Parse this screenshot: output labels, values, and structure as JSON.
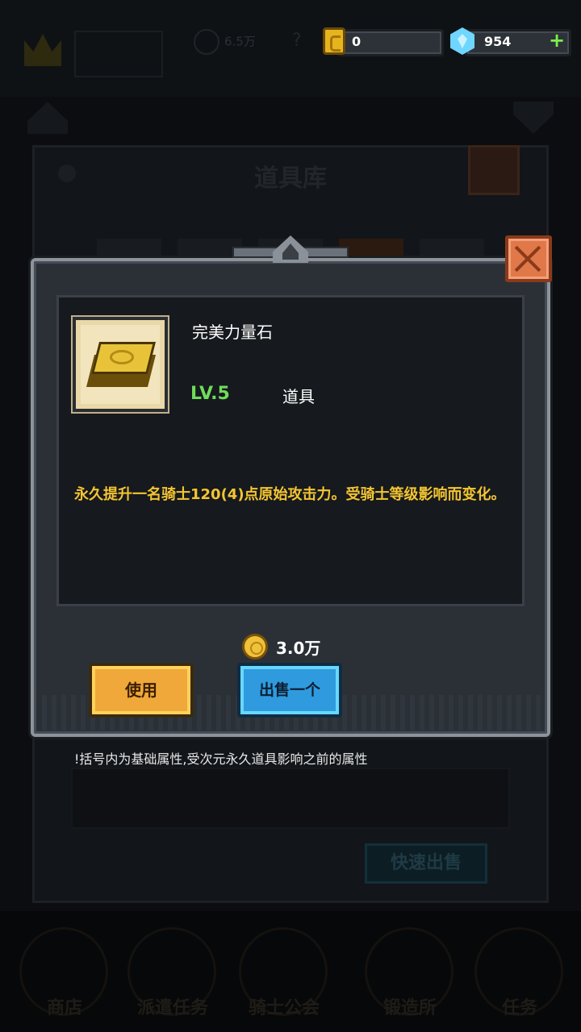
{
  "currency": {
    "gold_value": "0",
    "gem_value": "954",
    "add_icon": "plus-icon"
  },
  "background": {
    "window_title": "道具库",
    "power_value": "6.5万",
    "help_icon": "?",
    "quick_sell_label": "快速出售",
    "nav": [
      {
        "label": "商店"
      },
      {
        "label": "派遣任务"
      },
      {
        "label": "骑士公会"
      },
      {
        "label": "锻造所"
      },
      {
        "label": "任务"
      }
    ]
  },
  "item": {
    "name": "完美力量石",
    "level": "LV.5",
    "type": "道具",
    "description": "永久提升一名骑士120(4)点原始攻击力。受骑士等级影响而变化。",
    "icon": "gold-stone-icon",
    "price": "3.0万"
  },
  "actions": {
    "use_label": "使用",
    "sell_one_label": "出售一个"
  },
  "footnote": "!括号内为基础属性,受次元永久道具影响之前的属性",
  "colors": {
    "level_green": "#6fdc5a",
    "description_yellow": "#f4c531",
    "use_button": "#f0a83a",
    "sell_button": "#2f9bde",
    "close_button": "#e0784a"
  }
}
